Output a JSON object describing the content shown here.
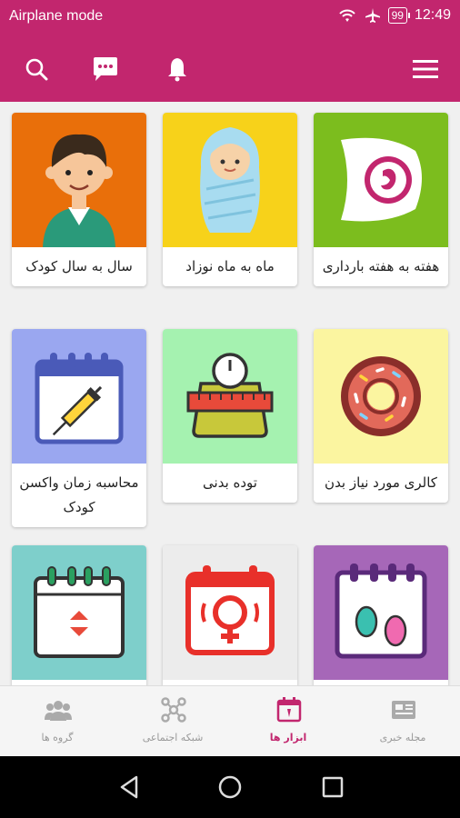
{
  "status_bar": {
    "mode_text": "Airplane mode",
    "battery": "99",
    "time": "12:49"
  },
  "toolbar": {
    "icons": [
      "search-icon",
      "chat-icon",
      "bell-icon",
      "menu-icon"
    ]
  },
  "colors": {
    "primary": "#c2266e"
  },
  "tools": [
    {
      "label": "هفته به هفته بارداری",
      "bg": "#7cbd1e"
    },
    {
      "label": "ماه به ماه نوزاد",
      "bg": "#f7d21a"
    },
    {
      "label": "سال به سال کودک",
      "bg": "#e96f0a"
    },
    {
      "label": "کالری مورد نیاز بدن",
      "bg": "#fbf5a0"
    },
    {
      "label": "توده بدنی",
      "bg": "#a5f2b0"
    },
    {
      "label": "محاسبه زمان واکسن کودک",
      "bg": "#9aa7f0"
    },
    {
      "label": "",
      "bg": "#a667b8"
    },
    {
      "label": "",
      "bg": "#ececec"
    },
    {
      "label": "",
      "bg": "#7ecfcb"
    }
  ],
  "bottom_nav": {
    "tabs": [
      {
        "label": "مجله خبری",
        "icon": "newspaper-icon"
      },
      {
        "label": "ابزار ها",
        "icon": "calendar-tool-icon",
        "active": true
      },
      {
        "label": "شبکه اجتماعی",
        "icon": "social-network-icon"
      },
      {
        "label": "گروه ها",
        "icon": "group-icon"
      }
    ]
  }
}
